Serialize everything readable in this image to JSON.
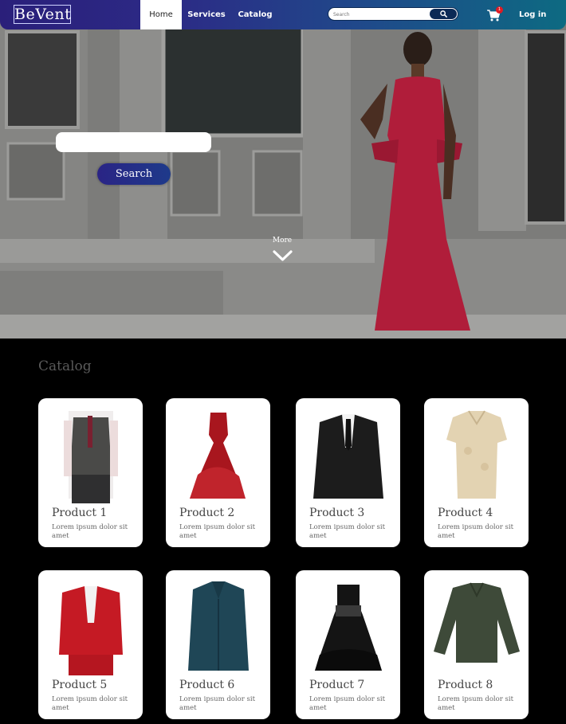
{
  "brand": {
    "logo": "BeVent"
  },
  "nav": {
    "items": [
      {
        "label": "Home",
        "active": true
      },
      {
        "label": "Services",
        "active": false
      },
      {
        "label": "Catalog",
        "active": false
      }
    ],
    "search_placeholder": "Search",
    "cart_count": "1",
    "login": "Log in"
  },
  "hero": {
    "search_button": "Search",
    "more_label": "More"
  },
  "catalog": {
    "title": "Catalog",
    "products": [
      {
        "name": "Product 1",
        "desc": "Lorem ipsum dolor sit amet",
        "icon": "vest-suit-icon"
      },
      {
        "name": "Product 2",
        "desc": "Lorem ipsum dolor sit amet",
        "icon": "red-ball-gown-icon"
      },
      {
        "name": "Product 3",
        "desc": "Lorem ipsum dolor sit amet",
        "icon": "black-suit-icon"
      },
      {
        "name": "Product 4",
        "desc": "Lorem ipsum dolor sit amet",
        "icon": "lace-blouse-icon"
      },
      {
        "name": "Product 5",
        "desc": "Lorem ipsum dolor sit amet",
        "icon": "red-blazer-icon"
      },
      {
        "name": "Product 6",
        "desc": "Lorem ipsum dolor sit amet",
        "icon": "teal-coat-icon"
      },
      {
        "name": "Product 7",
        "desc": "Lorem ipsum dolor sit amet",
        "icon": "black-dress-icon"
      },
      {
        "name": "Product 8",
        "desc": "Lorem ipsum dolor sit amet",
        "icon": "green-sweater-icon"
      }
    ]
  },
  "colors": {
    "nav_gradient_start": "#2a1f7a",
    "nav_gradient_end": "#0d6a82",
    "accent": "#2a2485",
    "badge": "#e01b24"
  }
}
